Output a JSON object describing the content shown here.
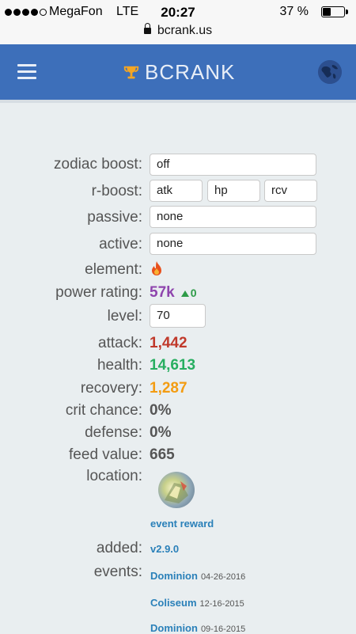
{
  "status_bar": {
    "carrier": "MegaFon",
    "network": "LTE",
    "time": "20:27",
    "battery": "37 %",
    "battery_level": 0.37,
    "url": "bcrank.us"
  },
  "nav": {
    "brand": "BCRANK",
    "brand_color": "#e8eef7",
    "bar_color": "#3d6fba",
    "menu_icon": "hamburger-menu-icon",
    "logo_icon": "trophy-icon",
    "globe_icon": "globe-icon"
  },
  "form": {
    "zodiac_boost": {
      "label": "zodiac boost:",
      "value": "off"
    },
    "r_boost": {
      "label": "r-boost:",
      "atk": "atk",
      "hp": "hp",
      "rcv": "rcv"
    },
    "passive": {
      "label": "passive:",
      "value": "none"
    },
    "active": {
      "label": "active:",
      "value": "none"
    },
    "level": {
      "label": "level:",
      "value": "70"
    }
  },
  "stats": {
    "element": {
      "label": "element:",
      "icon": "fire-icon"
    },
    "power_rating": {
      "label": "power rating:",
      "value": "57k",
      "delta": "0",
      "color": "#8e44ad"
    },
    "attack": {
      "label": "attack:",
      "value": "1,442",
      "color": "#c0392b"
    },
    "health": {
      "label": "health:",
      "value": "14,613",
      "color": "#27ae60"
    },
    "recovery": {
      "label": "recovery:",
      "value": "1,287",
      "color": "#f39c12"
    },
    "crit_chance": {
      "label": "crit chance:",
      "value": "0%",
      "color": "#555555"
    },
    "defense": {
      "label": "defense:",
      "value": "0%",
      "color": "#555555"
    },
    "feed_value": {
      "label": "feed value:",
      "value": "665",
      "color": "#555555"
    },
    "location": {
      "label": "location:",
      "link": "event reward"
    },
    "added": {
      "label": "added:",
      "value": "v2.9.0"
    },
    "events": {
      "label": "events:",
      "items": [
        {
          "name": "Dominion",
          "date": "04-26-2016"
        },
        {
          "name": "Coliseum",
          "date": "12-16-2015"
        },
        {
          "name": "Dominion",
          "date": "09-16-2015"
        }
      ]
    }
  }
}
